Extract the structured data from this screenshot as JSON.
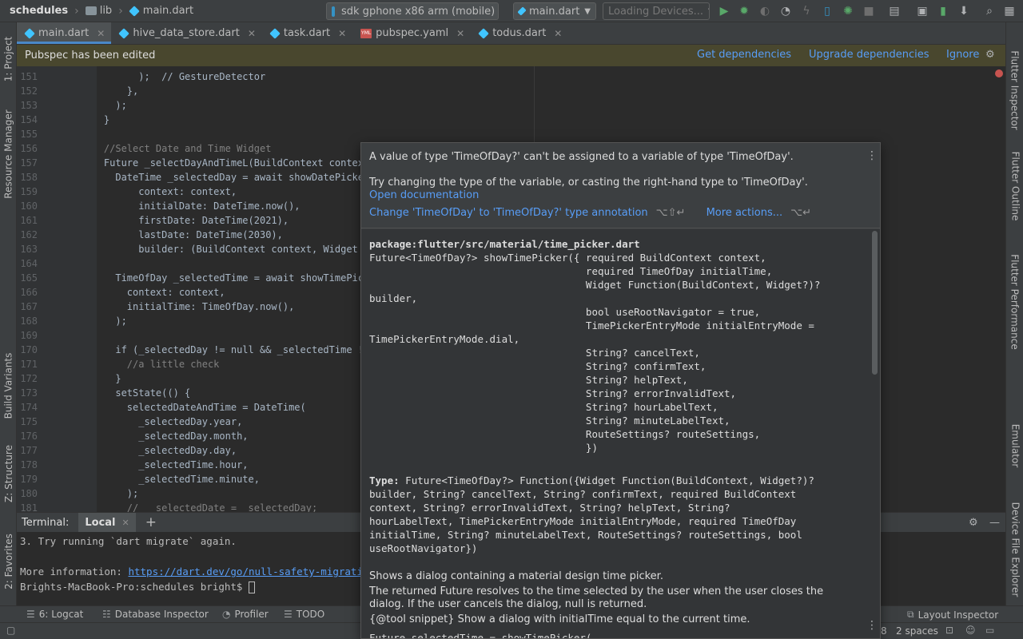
{
  "breadcrumb": {
    "project": "schedules",
    "folder": "lib",
    "file": "main.dart"
  },
  "toolbar": {
    "device_select": "sdk gphone x86 arm (mobile)",
    "config_select": "main.dart",
    "devices_select": "Loading Devices..."
  },
  "tabs": [
    {
      "label": "main.dart",
      "active": true
    },
    {
      "label": "hive_data_store.dart",
      "active": false
    },
    {
      "label": "task.dart",
      "active": false
    },
    {
      "label": "pubspec.yaml",
      "active": false
    },
    {
      "label": "todus.dart",
      "active": false
    }
  ],
  "notice": {
    "message": "Pubspec has been edited",
    "get_deps": "Get dependencies",
    "upgrade_deps": "Upgrade dependencies",
    "ignore": "Ignore"
  },
  "left_tools": {
    "project": "1: Project",
    "resource_manager": "Resource Manager",
    "build_variants": "Build Variants",
    "structure": "Z: Structure",
    "favorites": "2: Favorites"
  },
  "right_tools": {
    "flutter_inspector": "Flutter Inspector",
    "flutter_outline": "Flutter Outline",
    "flutter_performance": "Flutter Performance",
    "emulator": "Emulator",
    "device_file_explorer": "Device File Explorer"
  },
  "code_lines": [
    {
      "n": "151",
      "t": "          );  // GestureDetector"
    },
    {
      "n": "152",
      "t": "        },"
    },
    {
      "n": "153",
      "t": "      );"
    },
    {
      "n": "154",
      "t": "    }"
    },
    {
      "n": "155",
      "t": ""
    },
    {
      "n": "156",
      "t": "    //Select Date and Time Widget"
    },
    {
      "n": "157",
      "t": "    Future _selectDayAndTimeL(BuildContext context) async {"
    },
    {
      "n": "158",
      "t": "      DateTime _selectedDay = await showDatePicker("
    },
    {
      "n": "159",
      "t": "          context: context,"
    },
    {
      "n": "160",
      "t": "          initialDate: DateTime.now(),"
    },
    {
      "n": "161",
      "t": "          firstDate: DateTime(2021),"
    },
    {
      "n": "162",
      "t": "          lastDate: DateTime(2030),"
    },
    {
      "n": "163",
      "t": "          builder: (BuildContext context, Widget child) {"
    },
    {
      "n": "164",
      "t": ""
    },
    {
      "n": "165",
      "t": "      TimeOfDay _selectedTime = await showTimePicker("
    },
    {
      "n": "166",
      "t": "        context: context,"
    },
    {
      "n": "167",
      "t": "        initialTime: TimeOfDay.now(),"
    },
    {
      "n": "168",
      "t": "      );"
    },
    {
      "n": "169",
      "t": ""
    },
    {
      "n": "170",
      "t": "      if (_selectedDay != null && _selectedTime != null) {"
    },
    {
      "n": "171",
      "t": "        //a little check"
    },
    {
      "n": "172",
      "t": "      }"
    },
    {
      "n": "173",
      "t": "      setState(() {"
    },
    {
      "n": "174",
      "t": "        selectedDateAndTime = DateTime("
    },
    {
      "n": "175",
      "t": "          _selectedDay.year,"
    },
    {
      "n": "176",
      "t": "          _selectedDay.month,"
    },
    {
      "n": "177",
      "t": "          _selectedDay.day,"
    },
    {
      "n": "178",
      "t": "          _selectedTime.hour,"
    },
    {
      "n": "179",
      "t": "          _selectedTime.minute,"
    },
    {
      "n": "180",
      "t": "        );"
    },
    {
      "n": "181",
      "t": "        //  _selectedDate = _selectedDay;"
    }
  ],
  "terminal": {
    "title": "Terminal:",
    "tab": "Local",
    "line1": "3. Try running `dart migrate` again.",
    "more_info_label": "More information: ",
    "more_info_link": "https://dart.dev/go/null-safety-migration",
    "prompt": "Brights-MacBook-Pro:schedules bright$ "
  },
  "bottom_tools": {
    "logcat": "6: Logcat",
    "database_inspector": "Database Inspector",
    "profiler": "Profiler",
    "todo": "TODO",
    "layout_inspector": "Layout Inspector"
  },
  "status": {
    "indent": "2 spaces",
    "fragment": "8"
  },
  "popup": {
    "error": "A value of type 'TimeOfDay?' can't be assigned to a variable of type 'TimeOfDay'.",
    "hint": "Try changing the type of the variable, or casting the right-hand type to 'TimeOfDay'.",
    "open_docs": "Open documentation",
    "fix_action": "Change 'TimeOfDay' to 'TimeOfDay?' type annotation",
    "fix_shortcut": "⌥⇧↵",
    "more_actions": "More actions...",
    "more_shortcut": "⌥↵",
    "signature_lines": [
      "package:flutter/src/material/time_picker.dart",
      "Future<TimeOfDay?> showTimePicker({ required BuildContext context,",
      "                                    required TimeOfDay initialTime,",
      "                                    Widget Function(BuildContext, Widget?)?",
      "builder,",
      "                                    bool useRootNavigator = true,",
      "                                    TimePickerEntryMode initialEntryMode =",
      "TimePickerEntryMode.dial,",
      "                                    String? cancelText,",
      "                                    String? confirmText,",
      "                                    String? helpText,",
      "                                    String? errorInvalidText,",
      "                                    String? hourLabelText,",
      "                                    String? minuteLabelText,",
      "                                    RouteSettings? routeSettings,",
      "                                    })"
    ],
    "type_label": "Type:",
    "type_lines": [
      " Future<TimeOfDay?> Function({Widget Function(BuildContext, Widget?)?",
      "builder, String? cancelText, String? confirmText, required BuildContext",
      "context, String? errorInvalidText, String? helpText, String?",
      "hourLabelText, TimePickerEntryMode initialEntryMode, required TimeOfDay",
      "initialTime, String? minuteLabelText, RouteSettings? routeSettings, bool",
      "useRootNavigator})"
    ],
    "desc1": "Shows a dialog containing a material design time picker.",
    "desc2": "The returned Future resolves to the time selected by the user when the user closes the",
    "desc3": "dialog. If the user cancels the dialog, null is returned.",
    "snippet": "{@tool snippet} Show a dialog with initialTime equal to the current time.",
    "code_tail": "Future selectedTime = showTimePicker("
  },
  "colors": {
    "accent": "#589df6",
    "notice_bg": "#49472e",
    "editor_bg": "#2b2b2b",
    "panel_bg": "#3c3f41"
  }
}
